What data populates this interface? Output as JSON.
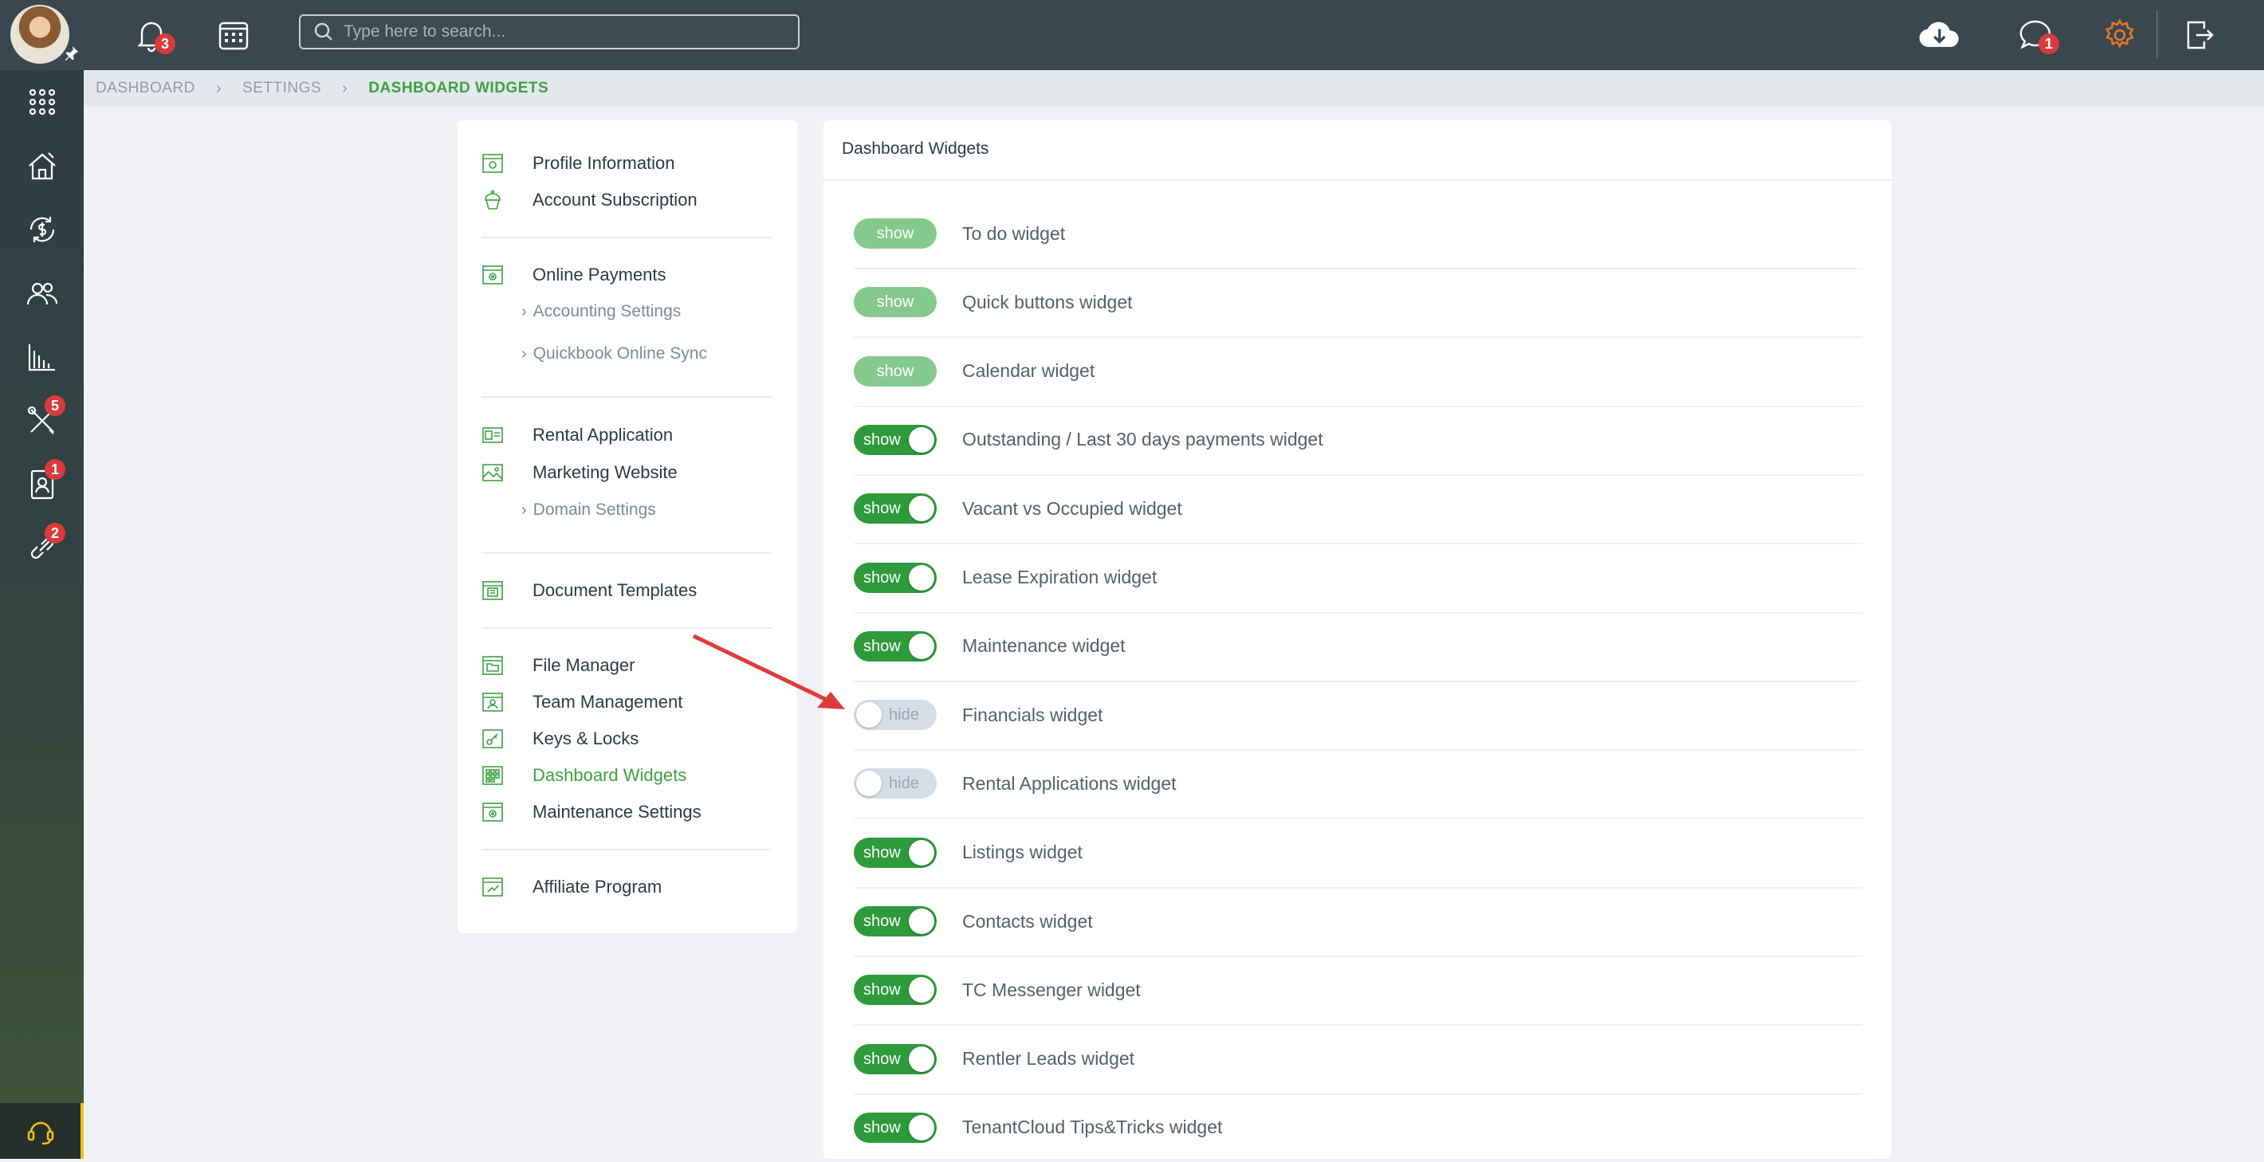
{
  "topbar": {
    "search_placeholder": "Type here to search...",
    "notifications_count": "3",
    "messages_count": "1"
  },
  "rail": {
    "badges": {
      "maintenance": "5",
      "contacts": "1",
      "links": "2"
    }
  },
  "breadcrumb": [
    "DASHBOARD",
    "SETTINGS",
    "DASHBOARD WIDGETS"
  ],
  "menu": {
    "profile": "Profile Information",
    "subscription": "Account Subscription",
    "online_payments": "Online Payments",
    "accounting": "Accounting Settings",
    "quickbook": "Quickbook Online Sync",
    "rental_application": "Rental Application",
    "marketing_website": "Marketing Website",
    "domain": "Domain Settings",
    "document_templates": "Document Templates",
    "file_manager": "File Manager",
    "team_management": "Team Management",
    "keys_locks": "Keys & Locks",
    "dashboard_widgets": "Dashboard Widgets",
    "maintenance_settings": "Maintenance Settings",
    "affiliate": "Affiliate Program"
  },
  "panel": {
    "title": "Dashboard Widgets",
    "widgets": [
      {
        "label": "To do widget",
        "state": "show",
        "style": "soft"
      },
      {
        "label": "Quick buttons widget",
        "state": "show",
        "style": "soft"
      },
      {
        "label": "Calendar widget",
        "state": "show",
        "style": "soft"
      },
      {
        "label": "Outstanding / Last 30 days payments widget",
        "state": "show",
        "style": "on"
      },
      {
        "label": "Vacant vs Occupied widget",
        "state": "show",
        "style": "on"
      },
      {
        "label": "Lease Expiration widget",
        "state": "show",
        "style": "on"
      },
      {
        "label": "Maintenance widget",
        "state": "show",
        "style": "on"
      },
      {
        "label": "Financials widget",
        "state": "hide",
        "style": "off"
      },
      {
        "label": "Rental Applications widget",
        "state": "hide",
        "style": "off"
      },
      {
        "label": "Listings widget",
        "state": "show",
        "style": "on"
      },
      {
        "label": "Contacts widget",
        "state": "show",
        "style": "on"
      },
      {
        "label": "TC Messenger widget",
        "state": "show",
        "style": "on"
      },
      {
        "label": "Rentler Leads widget",
        "state": "show",
        "style": "on"
      },
      {
        "label": "TenantCloud Tips&Tricks widget",
        "state": "show",
        "style": "on"
      }
    ]
  },
  "colors": {
    "accent": "#3da142",
    "toggle_on": "#2e9a3c",
    "toggle_soft": "#86c98e",
    "toggle_off": "#d7dde7",
    "badge": "#d93b3b",
    "gear": "#e07a2c"
  }
}
